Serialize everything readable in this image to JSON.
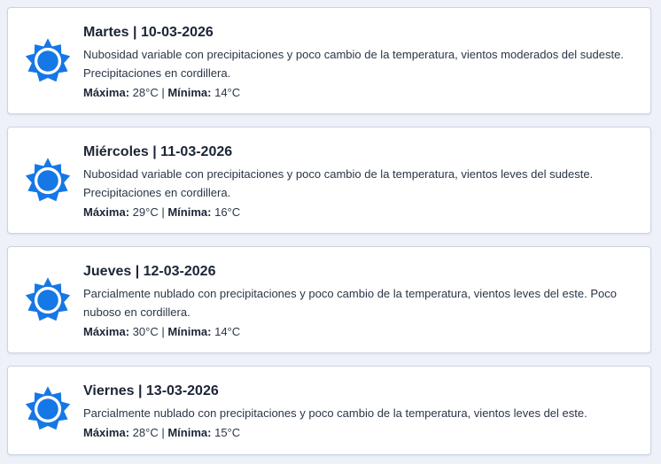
{
  "accent_color": "#1677e6",
  "days": [
    {
      "title": "Martes | 10-03-2026",
      "description": "Nubosidad variable con precipitaciones y poco cambio de la temperatura, vientos moderados del sudeste. Precipitaciones en cordillera.",
      "max_label": "Máxima:",
      "max_value": "28°C",
      "separator": "|",
      "min_label": "Mínima:",
      "min_value": "14°C",
      "icon": "sun-icon"
    },
    {
      "title": "Miércoles | 11-03-2026",
      "description": "Nubosidad variable con precipitaciones y poco cambio de la temperatura, vientos leves del sudeste. Precipitaciones en cordillera.",
      "max_label": "Máxima:",
      "max_value": "29°C",
      "separator": "|",
      "min_label": "Mínima:",
      "min_value": "16°C",
      "icon": "sun-icon"
    },
    {
      "title": "Jueves | 12-03-2026",
      "description": "Parcialmente nublado con precipitaciones y poco cambio de la temperatura, vientos leves del este. Poco nuboso en cordillera.",
      "max_label": "Máxima:",
      "max_value": "30°C",
      "separator": "|",
      "min_label": "Mínima:",
      "min_value": "14°C",
      "icon": "sun-icon"
    },
    {
      "title": "Viernes | 13-03-2026",
      "description": "Parcialmente nublado con precipitaciones y poco cambio de la temperatura, vientos leves del este.",
      "max_label": "Máxima:",
      "max_value": "28°C",
      "separator": "|",
      "min_label": "Mínima:",
      "min_value": "15°C",
      "icon": "sun-icon"
    }
  ]
}
